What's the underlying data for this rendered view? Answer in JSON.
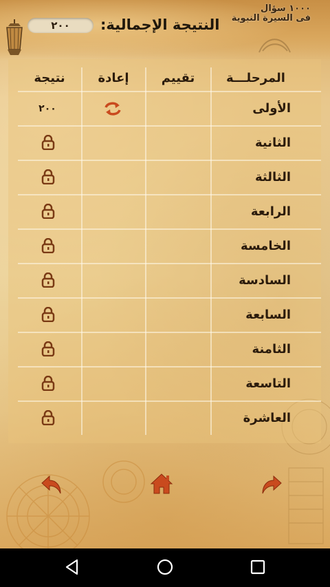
{
  "header": {
    "app_title_line1": "١٠٠٠ سؤال",
    "app_title_line2": "فى السيرة النبوية",
    "total_label": "النتيجة الإجمالية:",
    "total_value": "٢٠٠"
  },
  "table": {
    "columns": {
      "stage": "المرحلـــة",
      "rating": "تقييم",
      "retry": "إعادة",
      "result": "نتيجة"
    },
    "rows": [
      {
        "stage": "الأولى",
        "result": "٢٠٠",
        "locked": false,
        "retry_icon": "refresh-icon"
      },
      {
        "stage": "الثانية",
        "result": "",
        "locked": true
      },
      {
        "stage": "الثالثة",
        "result": "",
        "locked": true
      },
      {
        "stage": "الرابعة",
        "result": "",
        "locked": true
      },
      {
        "stage": "الخامسة",
        "result": "",
        "locked": true
      },
      {
        "stage": "السادسة",
        "result": "",
        "locked": true
      },
      {
        "stage": "السابعة",
        "result": "",
        "locked": true
      },
      {
        "stage": "الثامنة",
        "result": "",
        "locked": true
      },
      {
        "stage": "التاسعة",
        "result": "",
        "locked": true
      },
      {
        "stage": "العاشرة",
        "result": "",
        "locked": true
      }
    ]
  },
  "controls": {
    "back_icon": "arrow-back-icon",
    "home_icon": "home-icon",
    "next_icon": "arrow-forward-icon"
  },
  "system_nav": {
    "back_icon": "triangle-back-icon",
    "home_icon": "circle-home-icon",
    "recent_icon": "square-recents-icon"
  },
  "colors": {
    "accent": "#c94a1e",
    "text": "#2b1b0c",
    "parchment": "#e8c88a"
  }
}
